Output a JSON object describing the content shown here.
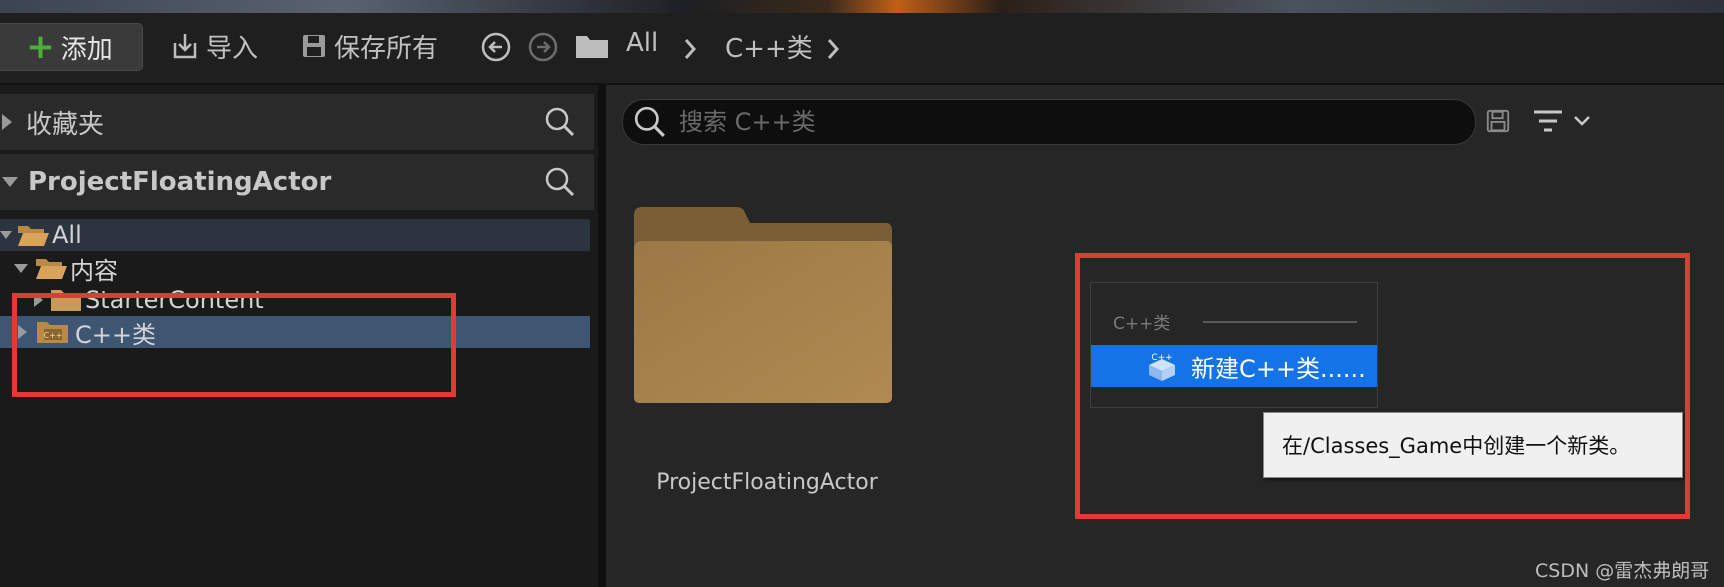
{
  "toolbar": {
    "add_label": "添加",
    "import_label": "导入",
    "save_all_label": "保存所有",
    "breadcrumb": [
      "All",
      "C++类"
    ]
  },
  "left_panel": {
    "favorites_label": "收藏夹",
    "project_label": "ProjectFloatingActor",
    "tree": [
      {
        "label": "All",
        "expanded": true,
        "selected": false
      },
      {
        "label": "内容",
        "expanded": true,
        "selected": false
      },
      {
        "label": "StarterContent",
        "expanded": false,
        "selected": false
      },
      {
        "label": "C++类",
        "expanded": false,
        "selected": true
      }
    ]
  },
  "content": {
    "search_placeholder": "搜索 C++类",
    "folder_name": "ProjectFloatingActor",
    "context_menu": {
      "header": "C++类",
      "item_label": "新建C++类......",
      "item_icon_text": "C++"
    },
    "tooltip": "在/Classes_Game中创建一个新类。"
  },
  "watermark": "CSDN @雷杰弗朗哥",
  "colors": {
    "selection": "#3f5673",
    "highlight": "#1473e6",
    "annotation_red": "#e53935",
    "add_icon": "#4caf3a",
    "folder": "#a8854e"
  }
}
